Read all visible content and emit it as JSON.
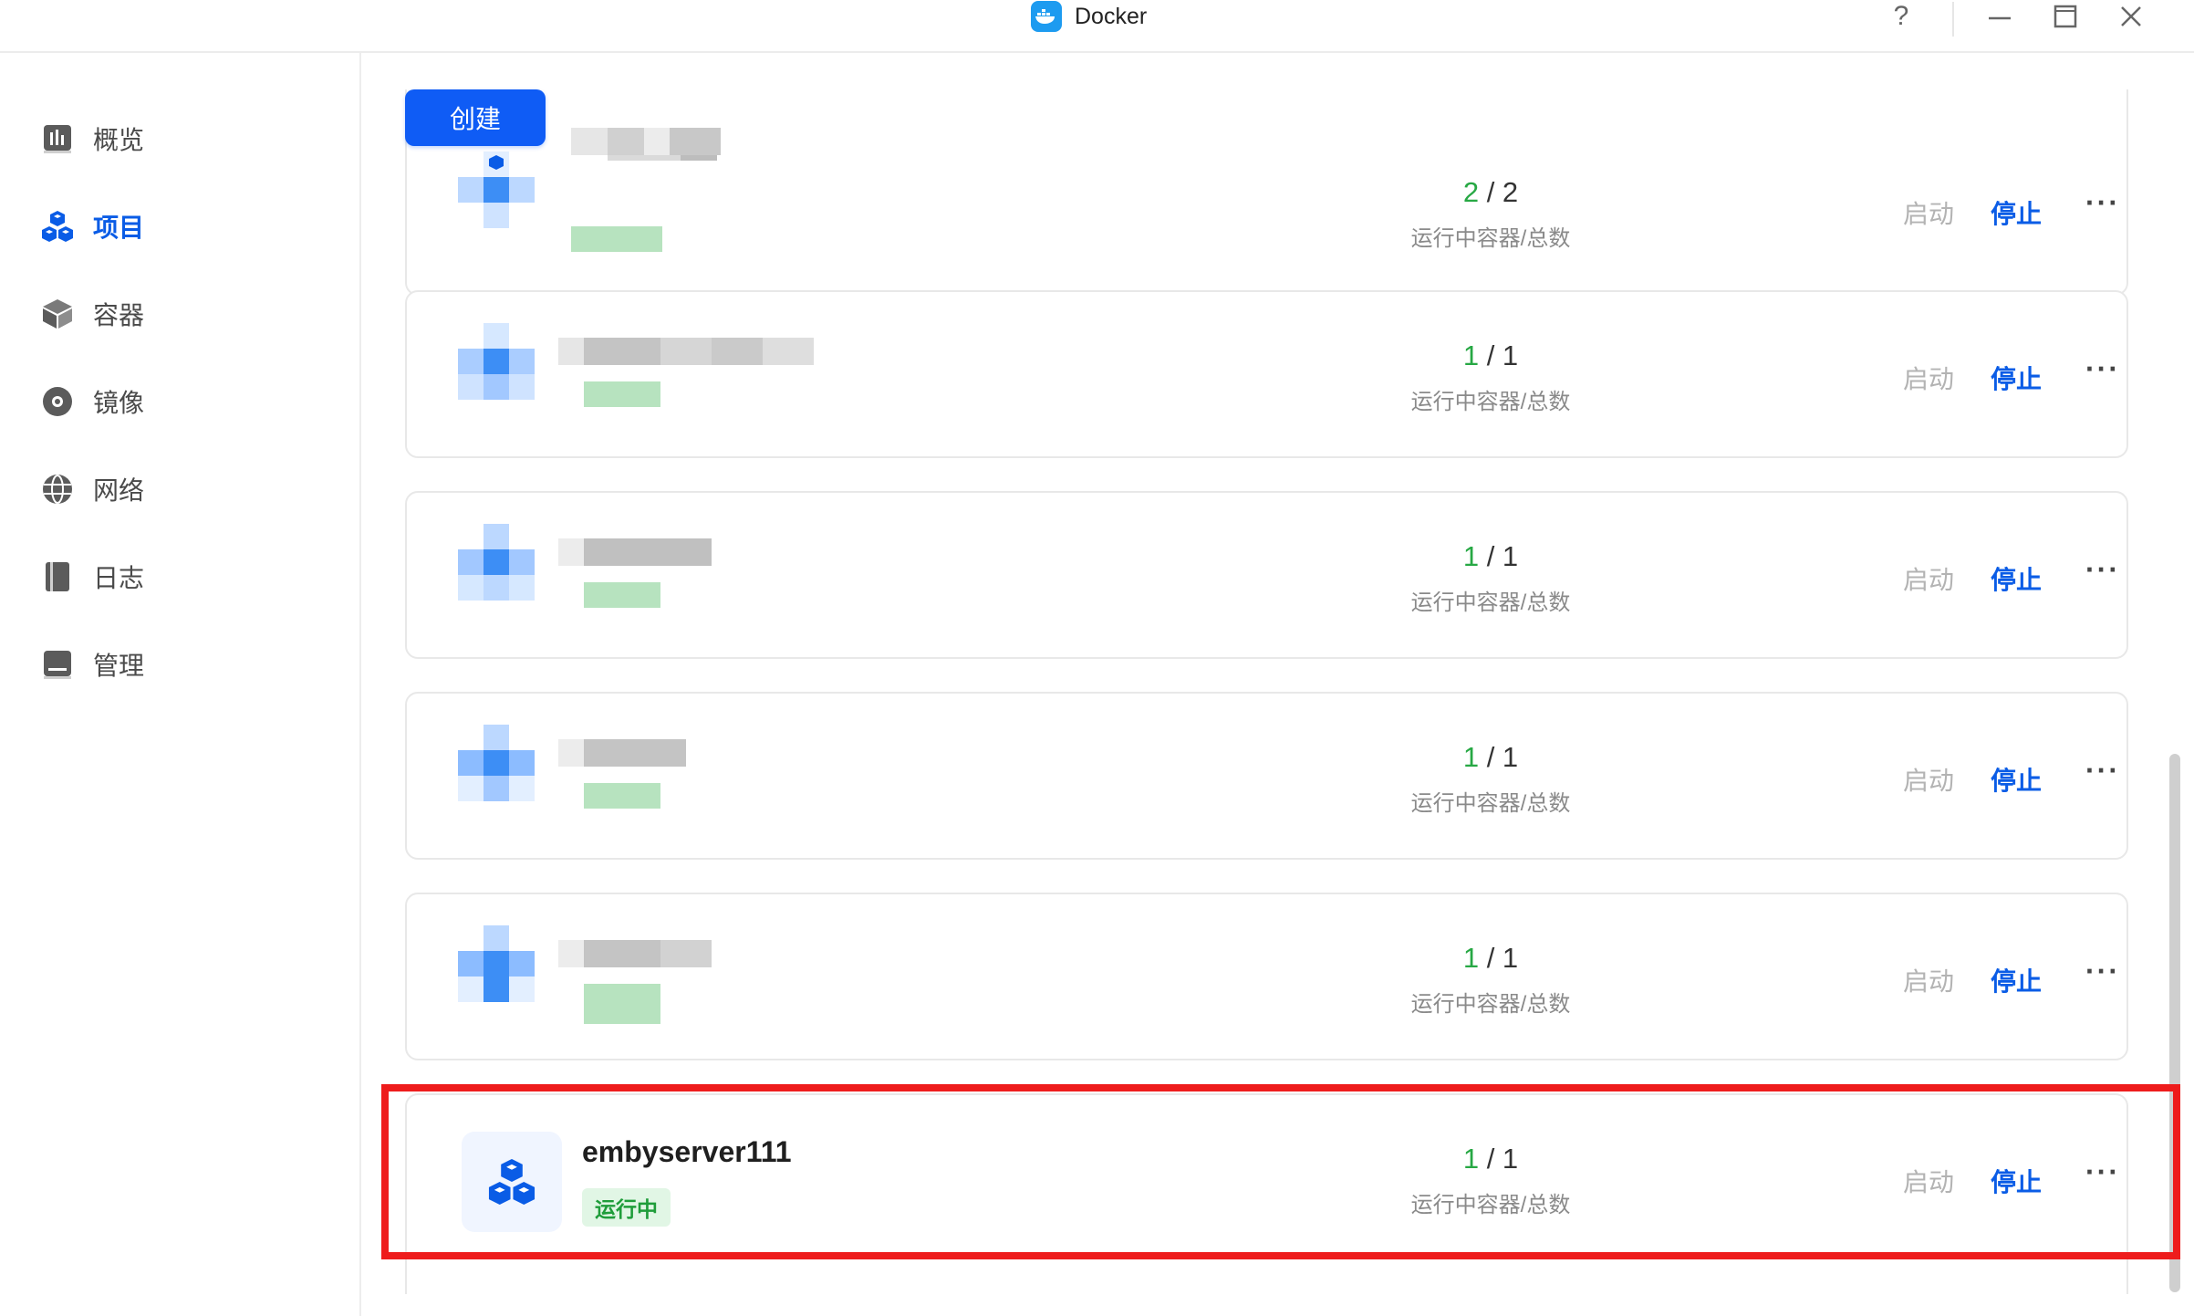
{
  "window": {
    "title": "Docker",
    "controls": [
      "help-icon",
      "minimize-icon",
      "maximize-icon",
      "close-icon"
    ],
    "help_label": "?"
  },
  "sidebar": {
    "items": [
      {
        "label": "概览",
        "icon": "overview-chart-icon",
        "active": false
      },
      {
        "label": "项目",
        "icon": "project-cubes-icon",
        "active": true
      },
      {
        "label": "容器",
        "icon": "container-box-icon",
        "active": false
      },
      {
        "label": "镜像",
        "icon": "image-disc-icon",
        "active": false
      },
      {
        "label": "网络",
        "icon": "network-globe-icon",
        "active": false
      },
      {
        "label": "日志",
        "icon": "log-book-icon",
        "active": false
      },
      {
        "label": "管理",
        "icon": "manage-panel-icon",
        "active": false
      }
    ]
  },
  "toolbar": {
    "create_label": "创建"
  },
  "projects": [
    {
      "running": "2",
      "total": "2",
      "caption": "运行中容器/总数",
      "start_label": "启动",
      "stop_label": "停止",
      "more_label": "···"
    },
    {
      "running": "1",
      "total": "1",
      "caption": "运行中容器/总数",
      "start_label": "启动",
      "stop_label": "停止",
      "more_label": "···"
    },
    {
      "running": "1",
      "total": "1",
      "caption": "运行中容器/总数",
      "start_label": "启动",
      "stop_label": "停止",
      "more_label": "···"
    },
    {
      "running": "1",
      "total": "1",
      "caption": "运行中容器/总数",
      "start_label": "启动",
      "stop_label": "停止",
      "more_label": "···"
    },
    {
      "running": "1",
      "total": "1",
      "caption": "运行中容器/总数",
      "start_label": "启动",
      "stop_label": "停止",
      "more_label": "···"
    },
    {
      "name": "embyserver111",
      "status": "运行中",
      "running": "1",
      "total": "1",
      "caption": "运行中容器/总数",
      "start_label": "启动",
      "stop_label": "停止",
      "more_label": "···"
    }
  ],
  "colors": {
    "accent": "#0a5ce6",
    "running": "#27a844",
    "highlight": "#ee1c1c"
  }
}
